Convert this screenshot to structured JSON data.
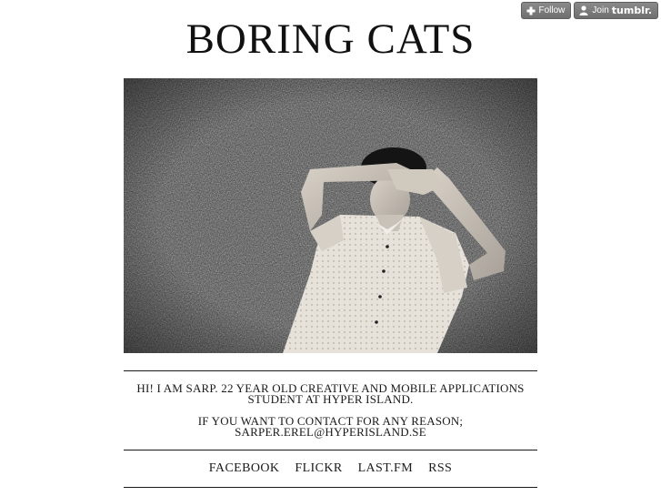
{
  "tumblr_controls": {
    "follow_label": "Follow",
    "join_label": "Join",
    "join_brand": "tumblr."
  },
  "site": {
    "title": "BORING CATS"
  },
  "bio": {
    "line1": "HI! I AM SARP. 22 YEAR OLD CREATIVE AND MOBILE APPLICATIONS",
    "line2": "STUDENT AT HYPER ISLAND.",
    "line3": "IF YOU WANT TO CONTACT FOR ANY REASON;",
    "email": "SARPER.EREL@HYPERISLAND.SE"
  },
  "social_links": [
    {
      "label": "FACEBOOK"
    },
    {
      "label": "FLICKR"
    },
    {
      "label": "LAST.FM"
    },
    {
      "label": "RSS"
    }
  ],
  "colors": {
    "text": "#1a1a1a",
    "button_bg": "#7d7d7d",
    "background": "#ffffff"
  }
}
